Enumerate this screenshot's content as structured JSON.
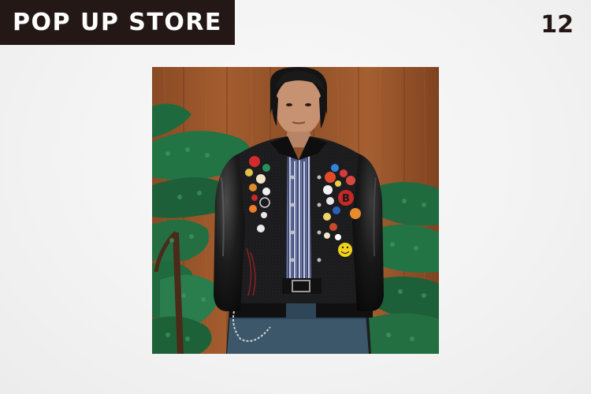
{
  "header": {
    "badge_label": "POP UP STORE",
    "page_number": "12"
  },
  "photo": {
    "subject": "person-in-black-varsity-jacket-with-pin-badges",
    "badge_texts": [
      "B"
    ]
  },
  "colors": {
    "badge_background": "#231815",
    "badge_text": "#ffffff",
    "page_background": "#f3f3f3"
  }
}
